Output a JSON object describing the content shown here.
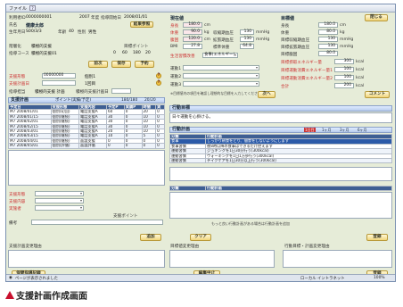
{
  "window": {
    "menu_file": "ファイル"
  },
  "patient": {
    "id_label": "利用者ID",
    "id_value": "0000000001",
    "year": "2007",
    "year_unit": "年度",
    "guidance_label": "指導開始日",
    "guidance_date": "2008/01/01",
    "name_label": "氏名",
    "name_value": "健康太郎",
    "result_button": "結果参照",
    "birth_label": "生年月日",
    "birth_value": "S00/3/3",
    "age_label": "年齢",
    "age_value": "40",
    "sex_label": "性別",
    "sex_value": "男性",
    "level_label": "階層化",
    "level_value": "積極的支援",
    "course_label": "指導コース",
    "course_value": "積極的支援01",
    "points_label": "目標ポイント",
    "pts_a": "0",
    "pts_b": "60",
    "pts_c": "180",
    "pts_d": "20",
    "btn_prev": "前次",
    "btn_save": "保存",
    "btn_schedule": "予約"
  },
  "support_form": {
    "field1_label": "支援形態",
    "field1_value": "00000000",
    "field1_right": "個別1",
    "field2_label": "支援計画日",
    "field2_right": "1回目",
    "field3_label": "指導担当",
    "field3_right": "積極的支援 計画",
    "field3_extra": "積極的支援計画日"
  },
  "support_plan": {
    "title": "支援計画",
    "points_info": "ポイント(実績/予定)",
    "points_value": "180/180",
    "points_total": "20/20",
    "columns": [
      "予定日",
      "支援形態",
      "支援内容",
      "予定P",
      "実績P",
      "時間",
      "実"
    ],
    "rows": [
      [
        "M7 2008/01/01",
        "個別(初回)",
        "電話支援A",
        "60",
        "0",
        "20",
        "0"
      ],
      [
        "M7 2008/01/15",
        "個別(継続)",
        "電話支援A",
        "30",
        "0",
        "10",
        "0"
      ],
      [
        "M7 2008/02/01",
        "個別(継続)",
        "電話支援A",
        "30",
        "0",
        "10",
        "0"
      ],
      [
        "M7 2008/02/15",
        "個別(継続)",
        "電話支援A",
        "30",
        "0",
        "10",
        "0"
      ],
      [
        "M7 2008/03/01",
        "個別(継続)",
        "電話支援A",
        "20",
        "0",
        "10",
        "0"
      ],
      [
        "M7 2008/03/15",
        "個別(継続)",
        "電話支援A",
        "10",
        "0",
        "5",
        "0"
      ],
      [
        "M7 2008/04/01",
        "個別(継続)",
        "面談支援",
        "0",
        "0",
        "0",
        "0"
      ],
      [
        "M7 2008/05/01",
        "個別(評価)",
        "面談評価",
        "0",
        "0",
        "0",
        "0"
      ]
    ]
  },
  "lower_left": {
    "f1": "支援形態",
    "f2": "支援内容",
    "f3": "実施者",
    "support_points": "支援ポイント",
    "remarks": "備考",
    "add_button": "追加",
    "reason_label": "支援計画変更理由",
    "history_button": "保健指導記録"
  },
  "current": {
    "title": "現在値",
    "height_label": "身長",
    "height_value": "180.0",
    "height_unit": "cm",
    "weight_label": "体重",
    "weight_value": "90.0",
    "weight_unit": "kg",
    "waist_label": "腹囲",
    "waist_value": "120.0",
    "waist_unit": "cm",
    "bmi_label": "BMI",
    "bmi_value": "27.8",
    "bp_sys_label": "収縮期血圧",
    "bp_sys_value": "130",
    "bp_unit": "mmHg",
    "bp_dia_label": "拡張期血圧",
    "bp_dia_value": "130",
    "std_weight_label": "標準体重",
    "std_weight_value": "64.8",
    "plan_label": "生活習慣改善",
    "plan_value": "食事(エネルギー)",
    "activity1": "運動1",
    "activity2": "運動2",
    "activity3": "運動3",
    "note": "※目標値内の項目を確認し理想的な目標を入力してください",
    "next_button": "次へ"
  },
  "target": {
    "title": "目標値",
    "close_button": "閉じる",
    "t_height_label": "身長",
    "t_height_value": "180.0",
    "t_height_unit": "cm",
    "t_weight_label": "体重",
    "t_weight_value": "80.0",
    "t_weight_unit": "kg",
    "t_sys_label": "目標収縮期血圧",
    "t_sys_value": "130",
    "t_unit": "mmHg",
    "t_dia_label": "目標拡張期血圧",
    "t_dia_value": "130",
    "t_waist_label": "目標腹囲",
    "t_waist_value": "80.0",
    "t_energy_label": "目標摂取エネルギー量",
    "t_energy_value": "300",
    "kcal": "kcal",
    "t_ex1_label": "目標運動消費エネルギー量1",
    "t_ex1_value": "100",
    "t_ex2_label": "目標運動消費エネルギー量2",
    "t_ex2_value": "100",
    "t_total_label": "合計",
    "t_total_value": "200",
    "comment_button": "コメント"
  },
  "action_goal": {
    "title": "行動目標",
    "goal_text": "日々運動を心掛ける。",
    "table_title": "行動計画",
    "legend": [
      "1日目",
      "1ヶ月",
      "3ヶ月",
      "6ヶ月"
    ],
    "columns": [
      "分類",
      "行動計画"
    ],
    "rows": [
      [
        "食事",
        "しっかり朝食をとり、間食をしないようにします"
      ],
      [
        "食事習慣",
        "夜8時以降の食事はできるだけ控えます"
      ],
      [
        "運動習慣",
        "ジョギングを1日30分行う(300kcal)"
      ],
      [
        "運動習慣",
        "ウォーキングを1日1万歩行う(300kcal)"
      ],
      [
        "運動習慣",
        "テイクケアを1日30分以上行う(300kcal)"
      ]
    ],
    "table2_columns": [
      "分類",
      "行動計画"
    ],
    "bottom_note": "もっと良い行動計画がある場合は行動計画を追加",
    "clear_button": "クリア",
    "register_button": "登録"
  },
  "change": {
    "reason_label": "目標値変更理由",
    "action_reason_label": "行動目標・計画変更理由",
    "edit_button": "編集中止",
    "register_button": "登録"
  },
  "status": {
    "left": "ページが表示されました",
    "zone": "ローカル イントラネット",
    "zoom": "100%"
  },
  "caption": "支援計画作成画面"
}
